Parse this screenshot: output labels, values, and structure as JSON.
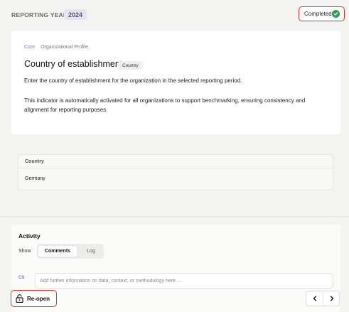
{
  "header": {
    "reporting_year_label": "REPORTING YEAR",
    "reporting_year_value": "2024",
    "status_label": "Completed",
    "status_icon": "check-circle-icon",
    "status_color": "#2e9e4f",
    "highlight_color": "#d9352b"
  },
  "indicator": {
    "breadcrumb_category": "Core",
    "breadcrumb_section": "Organizational Profile",
    "title": "Country of establishment",
    "tag": "Country",
    "description": "Enter the country of establishment for the organization in the selected reporting period.",
    "note": "This indicator is automatically activated for all organizations to support benchmarking, ensuring consistency and alignment for reporting purposes."
  },
  "answer": {
    "column_header": "Country",
    "value": "Germany"
  },
  "activity": {
    "title": "Activity",
    "show_label": "Show",
    "tabs": [
      {
        "label": "Comments",
        "selected": true
      },
      {
        "label": "Log",
        "selected": false
      }
    ],
    "avatar_initials": "CS",
    "comment_placeholder": "Add further information on data, context, or methodology here ..."
  },
  "footer": {
    "reopen_label": "Re-open",
    "reopen_icon": "unlock-icon",
    "prev_icon": "chevron-left-icon",
    "next_icon": "chevron-right-icon"
  }
}
